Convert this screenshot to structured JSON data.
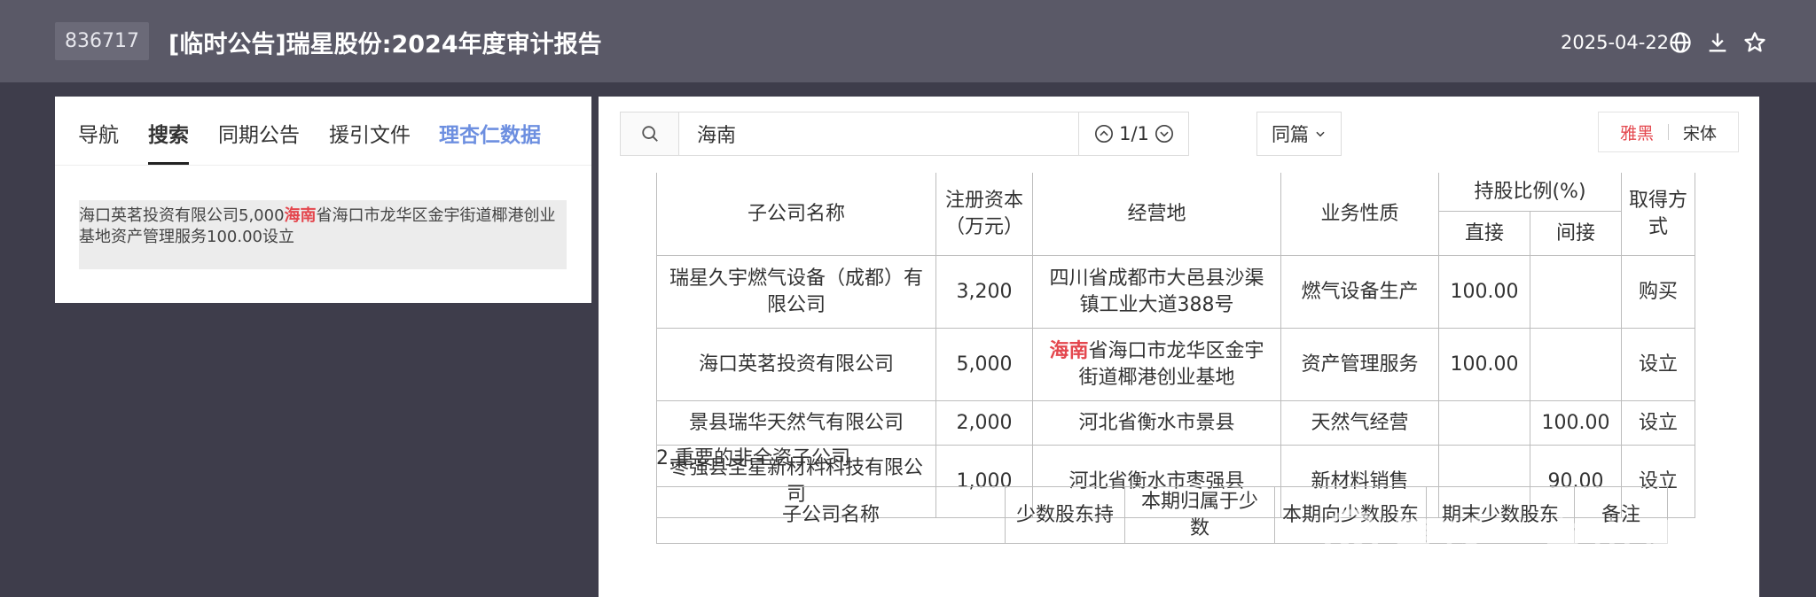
{
  "header": {
    "code": "836717",
    "title": "[临时公告]瑞星股份:2024年度审计报告",
    "date": "2025-04-22",
    "icons": [
      "globe-icon",
      "download-icon",
      "star-icon"
    ]
  },
  "left_tabs": [
    "导航",
    "搜索",
    "同期公告",
    "援引文件",
    "理杏仁数据"
  ],
  "search_result": {
    "before": "海口英茗投资有限公司5,000",
    "hit": "海南",
    "after": "省海口市龙华区金宇街道椰港创业基地资产管理服务100.00设立"
  },
  "search": {
    "query": "海南",
    "match_count": "1/1",
    "scope": "同篇"
  },
  "fonts": {
    "option1": "雅黑",
    "option2": "宋体"
  },
  "table1": {
    "headers": {
      "name": "子公司名称",
      "capital": "注册资本（万元）",
      "place": "经营地",
      "nature": "业务性质",
      "ratio": "持股比例(%)",
      "direct": "直接",
      "indirect": "间接",
      "method": "取得方式"
    },
    "rows": [
      {
        "name": "瑞星久宇燃气设备（成都）有限公司",
        "capital": "3,200",
        "place": "四川省成都市大邑县沙渠镇工业大道388号",
        "nature": "燃气设备生产",
        "direct": "100.00",
        "indirect": "",
        "method": "购买"
      },
      {
        "name": "海口英茗投资有限公司",
        "capital": "5,000",
        "place_hit": "海南",
        "place": "省海口市龙华区金宇街道椰港创业基地",
        "nature": "资产管理服务",
        "direct": "100.00",
        "indirect": "",
        "method": "设立"
      },
      {
        "name": "景县瑞华天然气有限公司",
        "capital": "2,000",
        "place": "河北省衡水市景县",
        "nature": "天然气经营",
        "direct": "",
        "indirect": "100.00",
        "method": "设立"
      },
      {
        "name": "枣强县圣星新材料科技有限公司",
        "capital": "1,000",
        "place": "河北省衡水市枣强县",
        "nature": "新材料销售",
        "direct": "",
        "indirect": "90.00",
        "method": "设立"
      }
    ]
  },
  "section2_heading": "2.重要的非全资子公司",
  "table2": {
    "headers": [
      "子公司名称",
      "少数股东持",
      "本期归属于少数",
      "本期向少数股东",
      "期末少数股东",
      "备注"
    ]
  },
  "watermark": "雪球：京市评论"
}
